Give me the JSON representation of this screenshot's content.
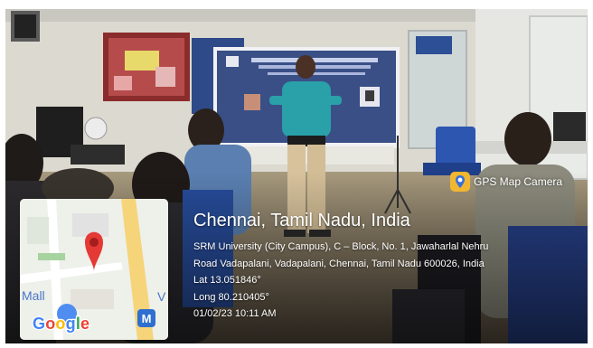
{
  "location": {
    "place": "Chennai, Tamil Nadu, India",
    "address_line1": "SRM University (City Campus), C – Block, No. 1, Jawaharlal Nehru",
    "address_line2": "Road Vadapalani, Vadapalani, Chennai, Tamil Nadu 600026, India",
    "latitude": "Lat 13.051846°",
    "longitude": "Long 80.210405°",
    "datetime": "01/02/23 10:11 AM"
  },
  "badge": {
    "label": "GPS Map Camera",
    "icon": "map-camera-icon"
  },
  "map": {
    "label_left": "Mall",
    "label_right": "V",
    "metro_label": "M",
    "google_logo": [
      "G",
      "o",
      "o",
      "g",
      "l",
      "e"
    ],
    "pin_color": "#e53935"
  },
  "colors": {
    "banner": "#3a4f86",
    "presenter_shirt": "#2aa0a8",
    "pin": "#e53935"
  }
}
